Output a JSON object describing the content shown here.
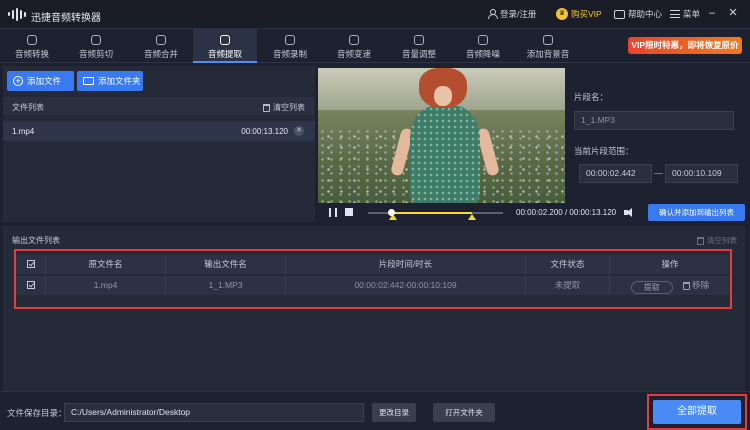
{
  "app": {
    "title": "迅捷音频转换器",
    "login": "登录/注册",
    "buy_vip": "购买VIP",
    "message_center": "帮助中心",
    "menu": "菜单"
  },
  "tabs": [
    {
      "label": "音频转换",
      "icon": "convert-icon"
    },
    {
      "label": "音频剪切",
      "icon": "scissors-icon"
    },
    {
      "label": "音频合并",
      "icon": "merge-icon"
    },
    {
      "label": "音频提取",
      "icon": "extract-icon",
      "active": true
    },
    {
      "label": "音频录制",
      "icon": "mic-icon"
    },
    {
      "label": "音频变速",
      "icon": "speed-icon"
    },
    {
      "label": "音量调整",
      "icon": "volume-icon"
    },
    {
      "label": "音频降噪",
      "icon": "denoise-icon"
    },
    {
      "label": "添加背景音",
      "icon": "music-icon"
    }
  ],
  "promo": "VIP限时特惠，即将恢复原价",
  "left": {
    "add_file": "添加文件",
    "add_folder": "添加文件夹",
    "file_list": "文件列表",
    "clear_list": "清空列表",
    "files": [
      {
        "name": "1.mp4",
        "duration": "00:00:13.120"
      }
    ]
  },
  "clip": {
    "name_label": "片段名：",
    "name_value": "1_1.MP3",
    "range_label": "当前片段范围：",
    "start": "00:00:02.442",
    "end": "00:00:10.109"
  },
  "player": {
    "current": "00:00:02.200",
    "separator": "/",
    "total": "00:00:13.120",
    "progress": 0.17,
    "selection_start": 0.186,
    "selection_end": 0.77,
    "confirm_label": "确认并添加到输出列表"
  },
  "output": {
    "title": "输出文件列表",
    "clear": "清空列表",
    "headers": [
      "原文件名",
      "输出文件名",
      "片段时间/时长",
      "文件状态",
      "操作"
    ],
    "rows": [
      {
        "source": "1.mp4",
        "output": "1_1.MP3",
        "span": "00:00:02:442-00:00:10:109",
        "status": "未提取",
        "action_extract": "提取",
        "action_remove": "移除"
      }
    ]
  },
  "bottom": {
    "save_dir_label": "文件保存目录：",
    "save_dir_value": "C:/Users/Administrator/Desktop",
    "change_dir": "更改目录",
    "open_folder": "打开文件夹",
    "extract_all": "全部提取"
  },
  "colors": {
    "accent": "#3a7af0",
    "highlight": "#e23c3c",
    "vip": "#f3c335",
    "selection": "#f2dd2a"
  }
}
